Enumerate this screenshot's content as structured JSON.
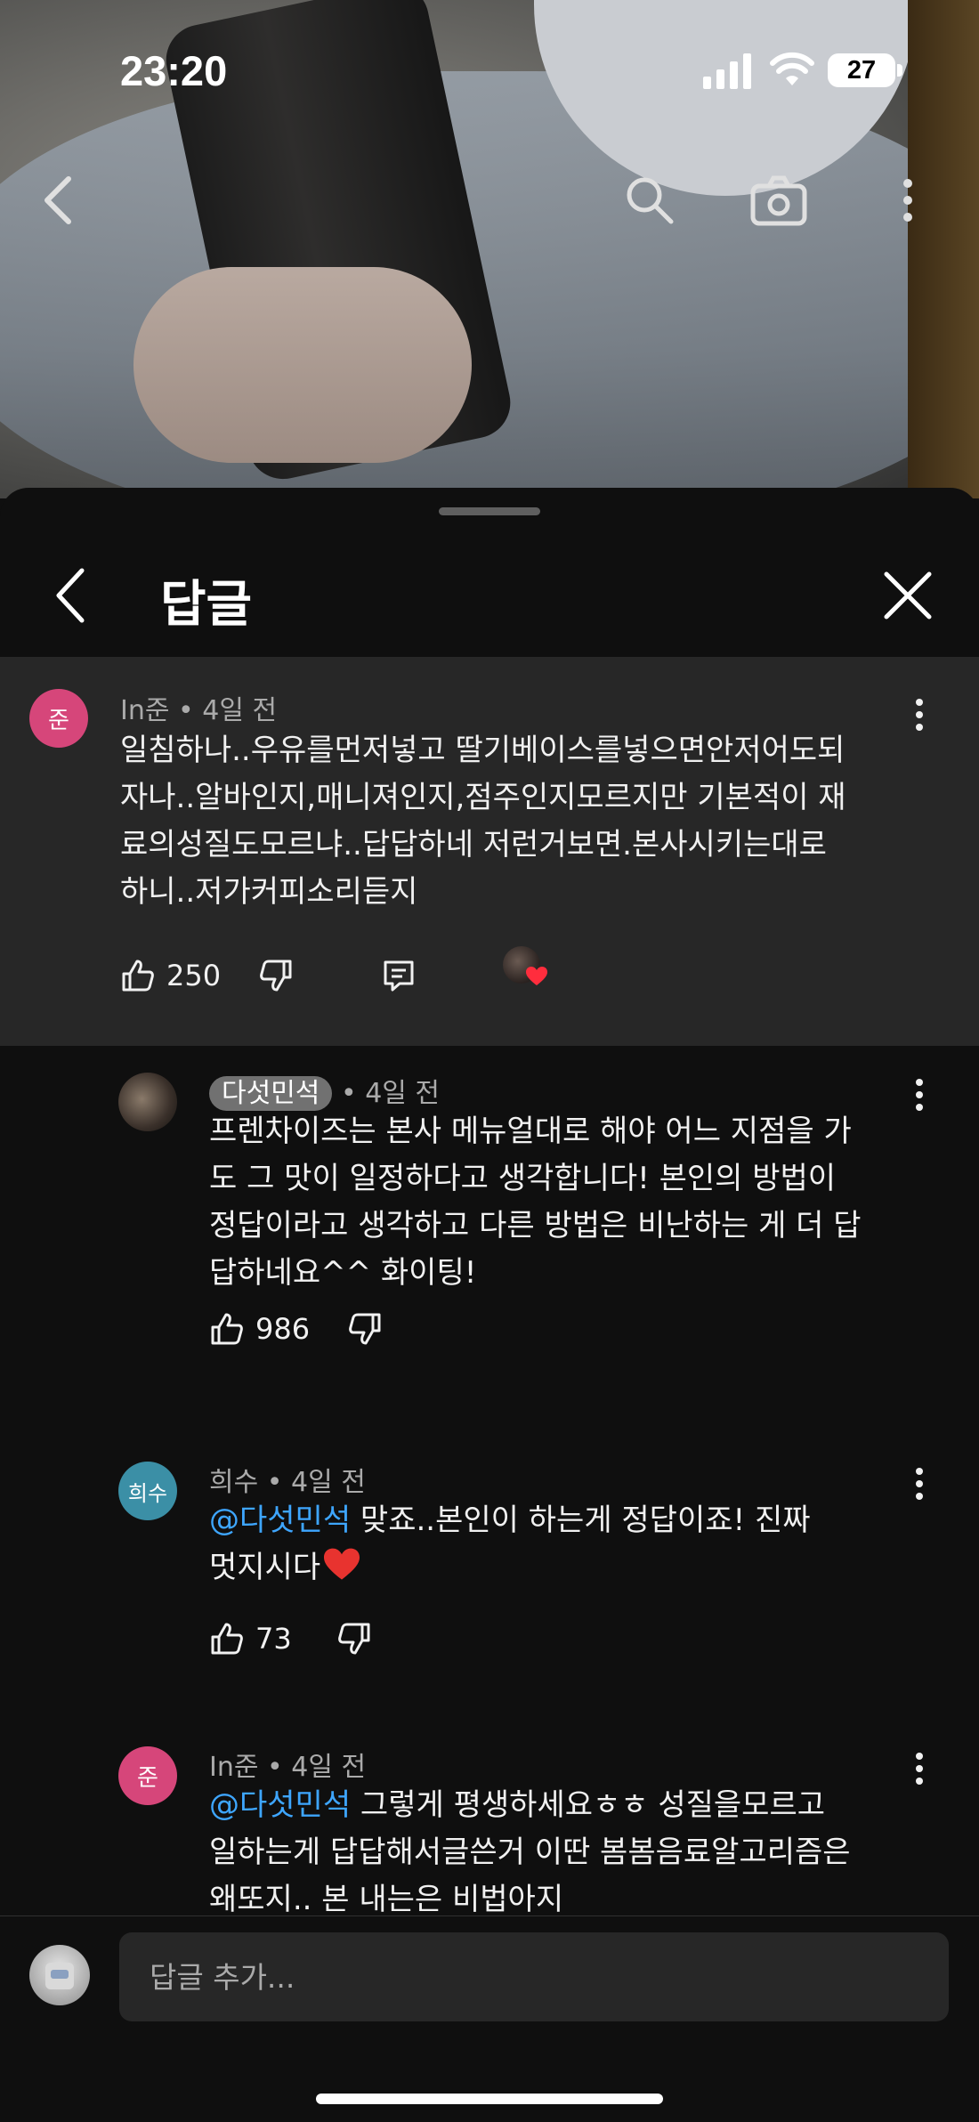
{
  "status_bar": {
    "time": "23:20",
    "battery": "27"
  },
  "sheet": {
    "title": "답글",
    "reply_placeholder": "답글 추가..."
  },
  "comments": [
    {
      "author": "In준",
      "age": "4일 전",
      "avatar_initial": "준",
      "avatar_color": "#d6467a",
      "lines": [
        "일침하나..우유를먼저넣고 딸기베이스를넣으면안저어도되",
        "자나..알바인지,매니져인지,점주인지모르지만 기본적이 재",
        "료의성질도모르냐..답답하네 저런거보면.본사시키는대로",
        "하니..저가커피소리듣지"
      ],
      "likes": "250"
    },
    {
      "author": "다섯민석",
      "age": "4일 전",
      "lines": [
        "프렌차이즈는 본사 메뉴얼대로 해야 어느 지점을 가",
        "도 그 맛이 일정하다고 생각합니다! 본인의 방법이",
        "정답이라고 생각하고 다른 방법은 비난하는 게 더 답",
        "답하네요^^ 화이팅!"
      ],
      "likes": "986"
    },
    {
      "author": "희수",
      "age": "4일 전",
      "avatar_initial": "희수",
      "avatar_color": "#3b8fa6",
      "mention": "@다섯민석",
      "line1_rest": " 맞죠..본인이 하는게 정답이죠! 진짜",
      "line2": "멋지시다",
      "likes": "73"
    },
    {
      "author": "In준",
      "age": "4일 전",
      "avatar_initial": "준",
      "avatar_color": "#d6467a",
      "mention": "@다섯민석",
      "line1_rest": " 그렇게 평생하세요ㅎㅎ 성질을모르고",
      "line2": "일하는게 답답해서글쓴거 이딴 봄봄음료알고리즘은",
      "line3": "왜또지.. 본 내는은 비법아지"
    }
  ],
  "meta_separator": " • ",
  "icons": [
    "back-arrow-icon",
    "search-icon",
    "camera-icon",
    "more-vert-icon",
    "chevron-left-icon",
    "close-icon",
    "thumb-up-icon",
    "thumb-down-icon",
    "reply-icon",
    "heart-icon"
  ],
  "colors": {
    "background": "#0f0f0f",
    "highlight": "#272727",
    "mention": "#3ea6ff"
  }
}
